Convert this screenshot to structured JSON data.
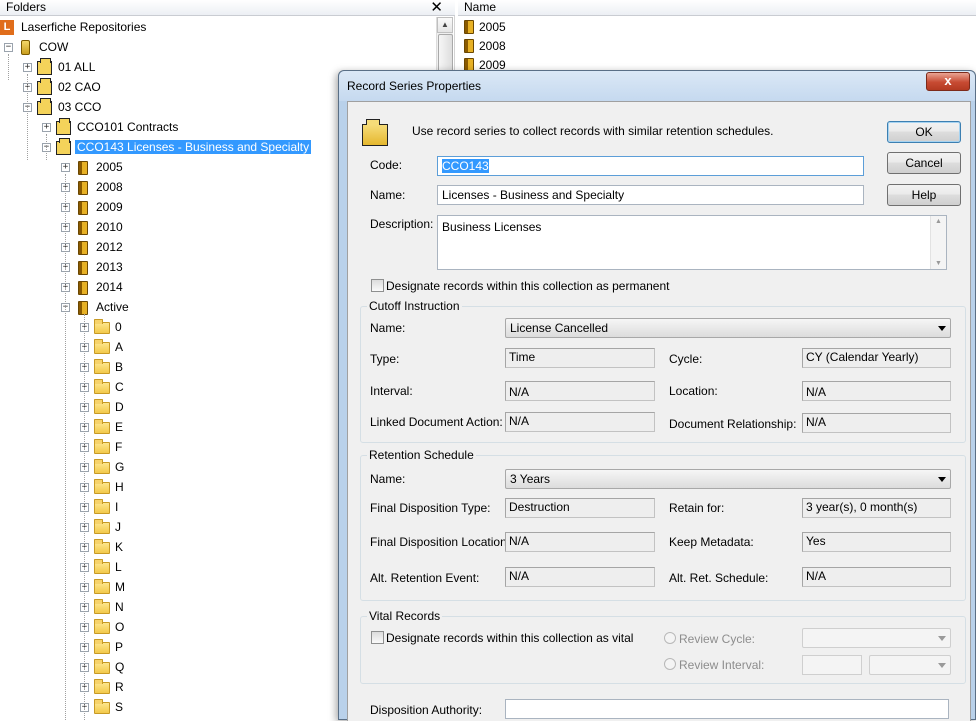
{
  "folders_pane": {
    "title": "Folders",
    "close_glyph": "✕",
    "tree": [
      {
        "label": "Laserfiche Repositories",
        "icon": "repository-icon",
        "level": 0,
        "expander": ""
      },
      {
        "label": "COW",
        "icon": "cabinet-icon",
        "level": 0,
        "expander": "−"
      },
      {
        "label": "01 ALL",
        "icon": "box-icon",
        "level": 1,
        "expander": "+"
      },
      {
        "label": "02 CAO",
        "icon": "box-icon",
        "level": 1,
        "expander": "+"
      },
      {
        "label": "03 CCO",
        "icon": "box-icon",
        "level": 1,
        "expander": "−"
      },
      {
        "label": "CCO101 Contracts",
        "icon": "box-icon",
        "level": 2,
        "expander": "+"
      },
      {
        "label": "CCO143 Licenses - Business and Specialty",
        "icon": "box-icon",
        "level": 2,
        "expander": "−",
        "selected": true
      },
      {
        "label": "2005",
        "icon": "book-icon",
        "level": 3,
        "expander": "+"
      },
      {
        "label": "2008",
        "icon": "book-icon",
        "level": 3,
        "expander": "+"
      },
      {
        "label": "2009",
        "icon": "book-icon",
        "level": 3,
        "expander": "+"
      },
      {
        "label": "2010",
        "icon": "book-icon",
        "level": 3,
        "expander": "+"
      },
      {
        "label": "2012",
        "icon": "book-icon",
        "level": 3,
        "expander": "+"
      },
      {
        "label": "2013",
        "icon": "book-icon",
        "level": 3,
        "expander": "+"
      },
      {
        "label": "2014",
        "icon": "book-icon",
        "level": 3,
        "expander": "+"
      },
      {
        "label": "Active",
        "icon": "book-icon",
        "level": 3,
        "expander": "−"
      },
      {
        "label": "0",
        "icon": "folder-icon",
        "level": 4,
        "expander": "+"
      },
      {
        "label": "A",
        "icon": "folder-icon",
        "level": 4,
        "expander": "+"
      },
      {
        "label": "B",
        "icon": "folder-icon",
        "level": 4,
        "expander": "+"
      },
      {
        "label": "C",
        "icon": "folder-icon",
        "level": 4,
        "expander": "+"
      },
      {
        "label": "D",
        "icon": "folder-icon",
        "level": 4,
        "expander": "+"
      },
      {
        "label": "E",
        "icon": "folder-icon",
        "level": 4,
        "expander": "+"
      },
      {
        "label": "F",
        "icon": "folder-icon",
        "level": 4,
        "expander": "+"
      },
      {
        "label": "G",
        "icon": "folder-icon",
        "level": 4,
        "expander": "+"
      },
      {
        "label": "H",
        "icon": "folder-icon",
        "level": 4,
        "expander": "+"
      },
      {
        "label": "I",
        "icon": "folder-icon",
        "level": 4,
        "expander": "+"
      },
      {
        "label": "J",
        "icon": "folder-icon",
        "level": 4,
        "expander": "+"
      },
      {
        "label": "K",
        "icon": "folder-icon",
        "level": 4,
        "expander": "+"
      },
      {
        "label": "L",
        "icon": "folder-icon",
        "level": 4,
        "expander": "+"
      },
      {
        "label": "M",
        "icon": "folder-icon",
        "level": 4,
        "expander": "+"
      },
      {
        "label": "N",
        "icon": "folder-icon",
        "level": 4,
        "expander": "+"
      },
      {
        "label": "O",
        "icon": "folder-icon",
        "level": 4,
        "expander": "+"
      },
      {
        "label": "P",
        "icon": "folder-icon",
        "level": 4,
        "expander": "+"
      },
      {
        "label": "Q",
        "icon": "folder-icon",
        "level": 4,
        "expander": "+"
      },
      {
        "label": "R",
        "icon": "folder-icon",
        "level": 4,
        "expander": "+"
      },
      {
        "label": "S",
        "icon": "folder-icon",
        "level": 4,
        "expander": "+"
      }
    ]
  },
  "list_pane": {
    "column_name": "Name",
    "items": [
      "2005",
      "2008",
      "2009"
    ]
  },
  "dialog": {
    "title": "Record Series Properties",
    "close_glyph": "x",
    "intro": "Use record series to collect records with similar retention schedules.",
    "buttons": {
      "ok": "OK",
      "cancel": "Cancel",
      "help": "Help"
    },
    "code_label": "Code:",
    "code_value": "CCO143",
    "name_label": "Name:",
    "name_value": "Licenses - Business and Specialty",
    "description_label": "Description:",
    "description_value": "Business Licenses",
    "permanent_label": "Designate records within this collection as permanent",
    "cutoff": {
      "title": "Cutoff Instruction",
      "name_label": "Name:",
      "name_value": "License Cancelled",
      "type_label": "Type:",
      "type_value": "Time",
      "cycle_label": "Cycle:",
      "cycle_value": "CY (Calendar Yearly)",
      "interval_label": "Interval:",
      "interval_value": "N/A",
      "location_label": "Location:",
      "location_value": "N/A",
      "linked_label": "Linked Document Action:",
      "linked_value": "N/A",
      "relationship_label": "Document Relationship:",
      "relationship_value": "N/A"
    },
    "retention": {
      "title": "Retention Schedule",
      "name_label": "Name:",
      "name_value": "3 Years",
      "fdt_label": "Final Disposition Type:",
      "fdt_value": "Destruction",
      "retain_label": "Retain for:",
      "retain_value": "3 year(s), 0 month(s)",
      "fdl_label": "Final Disposition Location:",
      "fdl_value": "N/A",
      "keep_label": "Keep Metadata:",
      "keep_value": "Yes",
      "alt_event_label": "Alt. Retention Event:",
      "alt_event_value": "N/A",
      "alt_sched_label": "Alt. Ret. Schedule:",
      "alt_sched_value": "N/A"
    },
    "vital": {
      "title": "Vital Records",
      "checkbox_label": "Designate records within this collection as vital",
      "review_cycle_label": "Review Cycle:",
      "review_interval_label": "Review Interval:"
    },
    "disposition_authority_label": "Disposition Authority:",
    "disposition_authority_value": ""
  },
  "colors": {
    "selection": "#3399ff",
    "dialog_frame": "#b9d1ea",
    "close_button": "#c74a32"
  }
}
